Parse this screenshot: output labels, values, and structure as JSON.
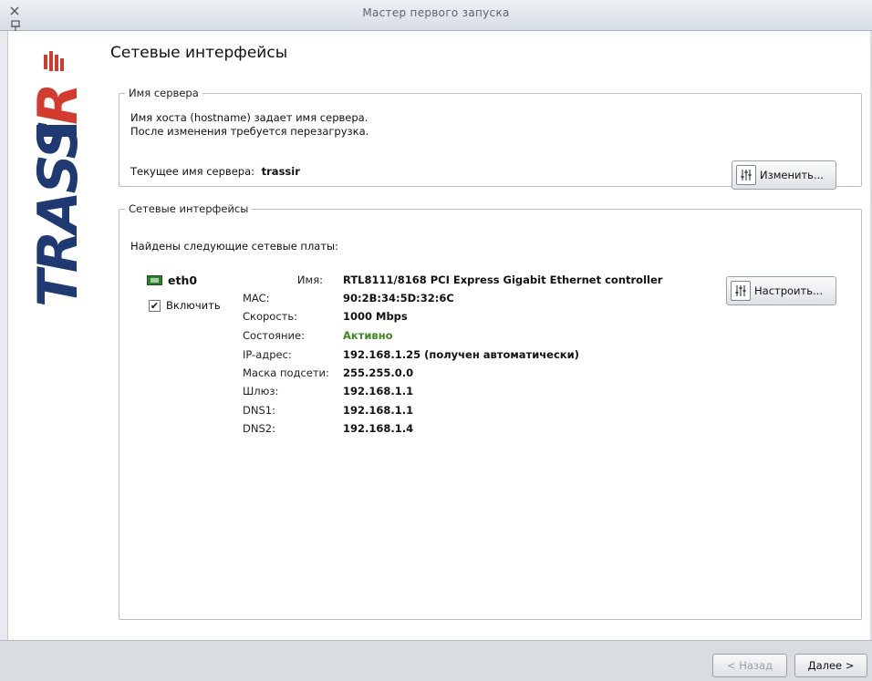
{
  "window": {
    "title": "Мастер первого запуска"
  },
  "page_title": "Сетевые интерфейсы",
  "server_group": {
    "legend": "Имя сервера",
    "desc_line1": "Имя хоста (hostname) задает имя сервера.",
    "desc_line2": "После изменения требуется перезагрузка.",
    "current_label": "Текущее имя сервера:",
    "current_value": "trassir",
    "change_button": "Изменить..."
  },
  "net_group": {
    "legend": "Сетевые интерфейсы",
    "found_text": "Найдены следующие сетевые платы:",
    "interface": {
      "name": "eth0",
      "enable_label": "Включить",
      "enabled": true,
      "configure_button": "Настроить...",
      "props": {
        "name_label": "Имя:",
        "name_value": "RTL8111/8168 PCI Express Gigabit Ethernet controller",
        "mac_label": "MAC:",
        "mac_value": "90:2B:34:5D:32:6C",
        "speed_label": "Скорость:",
        "speed_value": "1000 Mbps",
        "state_label": "Состояние:",
        "state_value": "Активно",
        "ip_label": "IP-адрес:",
        "ip_value": "192.168.1.25 (получен автоматически)",
        "mask_label": "Маска подсети:",
        "mask_value": "255.255.0.0",
        "gw_label": "Шлюз:",
        "gw_value": "192.168.1.1",
        "dns1_label": "DNS1:",
        "dns1_value": "192.168.1.1",
        "dns2_label": "DNS2:",
        "dns2_value": "192.168.1.4"
      }
    }
  },
  "footer": {
    "back_label": "< Назад",
    "next_label": "Далее >"
  },
  "colors": {
    "logo_navy": "#1f3a73",
    "logo_red": "#d43b2f",
    "active_green": "#3a8a1f"
  },
  "icons": {
    "close": "close-icon",
    "pin": "pin-icon",
    "settings": "sliders-icon",
    "network_card": "network-card-icon",
    "checkbox": "checkmark-icon"
  },
  "logo_text": "TRASSIR"
}
